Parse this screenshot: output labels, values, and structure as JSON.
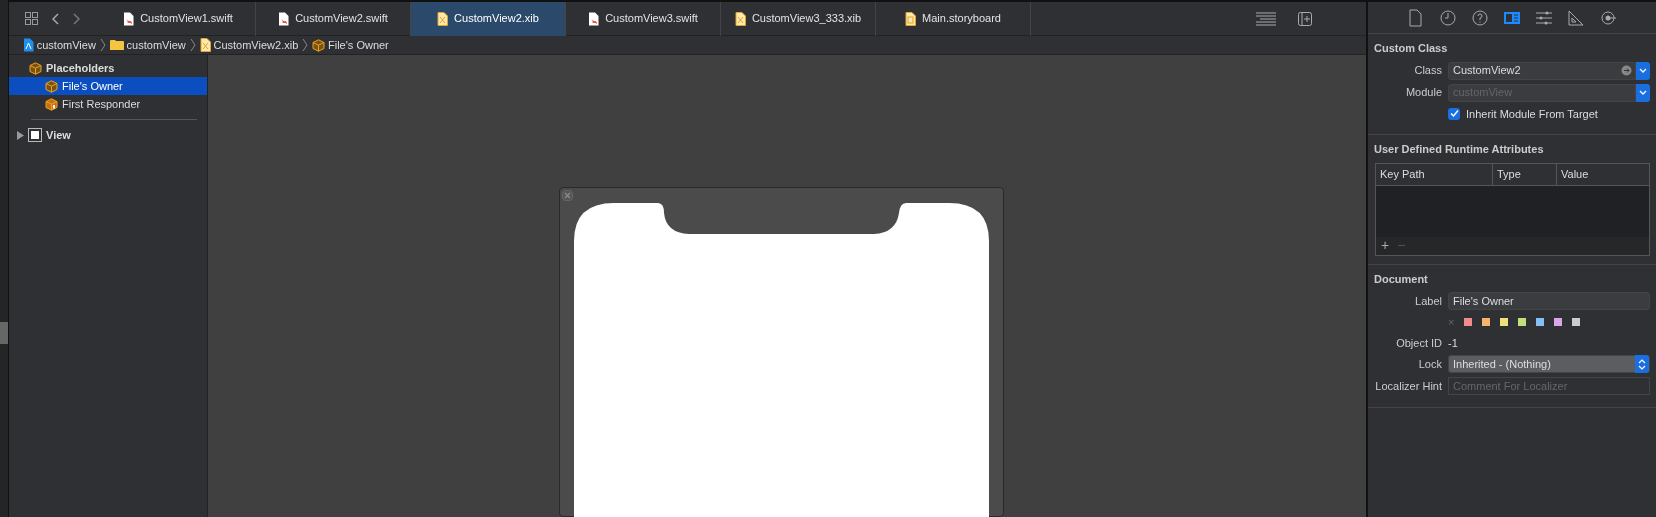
{
  "tabs": [
    {
      "label": "CustomView1.swift",
      "kind": "swift",
      "selected": false
    },
    {
      "label": "CustomView2.swift",
      "kind": "swift",
      "selected": false
    },
    {
      "label": "CustomView2.xib",
      "kind": "xib",
      "selected": true
    },
    {
      "label": "CustomView3.swift",
      "kind": "swift",
      "selected": false
    },
    {
      "label": "CustomView3_333.xib",
      "kind": "xib",
      "selected": false
    },
    {
      "label": "Main.storyboard",
      "kind": "storyboard",
      "selected": false
    }
  ],
  "breadcrumb": [
    {
      "label": "customView",
      "kind": "project"
    },
    {
      "label": "customView",
      "kind": "folder"
    },
    {
      "label": "CustomView2.xib",
      "kind": "xib"
    },
    {
      "label": "File's Owner",
      "kind": "cube"
    }
  ],
  "outline": [
    {
      "label": "Placeholders",
      "kind": "cube",
      "selected": false,
      "expanded": true,
      "children": [
        {
          "label": "File's Owner",
          "kind": "cube",
          "selected": true
        },
        {
          "label": "First Responder",
          "kind": "responder",
          "selected": false
        }
      ]
    },
    {
      "label": "View",
      "kind": "view",
      "selected": false,
      "expanded": false
    }
  ],
  "inspector": {
    "tabs": [
      {
        "kind": "file",
        "selected": false
      },
      {
        "kind": "history",
        "selected": false
      },
      {
        "kind": "help",
        "selected": false
      },
      {
        "kind": "identity",
        "selected": true
      },
      {
        "kind": "attributes",
        "selected": false
      },
      {
        "kind": "size",
        "selected": false
      },
      {
        "kind": "connections",
        "selected": false
      }
    ],
    "custom_class": {
      "title": "Custom Class",
      "class_label": "Class",
      "class_value": "CustomView2",
      "module_label": "Module",
      "module_placeholder": "customView",
      "inherit_label": "Inherit Module From Target",
      "inherit_checked": true
    },
    "runtime_attributes": {
      "title": "User Defined Runtime Attributes",
      "columns": [
        "Key Path",
        "Type",
        "Value"
      ],
      "add": "+",
      "remove": "−"
    },
    "document": {
      "title": "Document",
      "label_label": "Label",
      "label_value": "File's Owner",
      "colors": [
        {
          "color": "#f28b8b"
        },
        {
          "color": "#f5b36e"
        },
        {
          "color": "#f0e27a"
        },
        {
          "color": "#c3de7a"
        },
        {
          "color": "#86bff5"
        },
        {
          "color": "#d6a6e6"
        },
        {
          "color": "#cccccc"
        }
      ],
      "clear": "×",
      "object_id_label": "Object ID",
      "object_id": "-1",
      "lock_label": "Lock",
      "lock_value": "Inherited - (Nothing)",
      "hint_label": "Localizer Hint",
      "hint_placeholder": "Comment For Localizer"
    }
  }
}
